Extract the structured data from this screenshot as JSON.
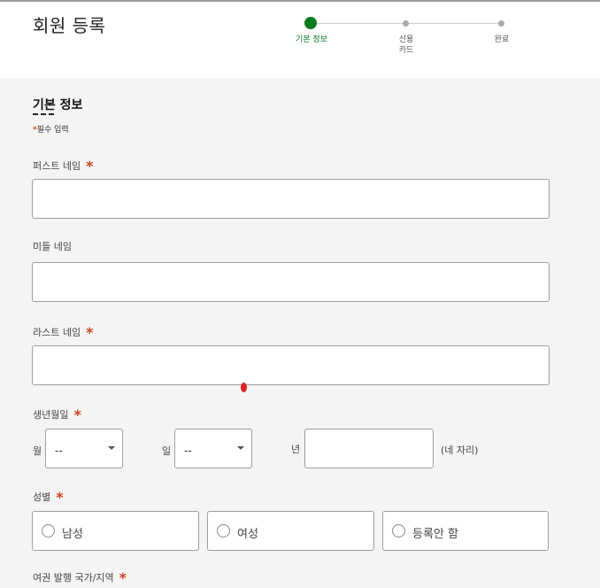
{
  "page": {
    "title": "회원 등록"
  },
  "stepper": {
    "steps": [
      {
        "label": "기본 정보",
        "state": "active"
      },
      {
        "label": "신용\n카드",
        "state": "pending"
      },
      {
        "label": "완료",
        "state": "pending"
      }
    ],
    "active_color": "#0a7a1f"
  },
  "form": {
    "section_title": "기본 정보",
    "required_star": "*",
    "required_note": "필수 입력",
    "first_name": {
      "label": "퍼스트 네임",
      "value": ""
    },
    "middle_name": {
      "label": "미들 네임",
      "value": ""
    },
    "last_name": {
      "label": "라스트 네임",
      "value": ""
    },
    "dob": {
      "label": "생년월일",
      "month_label": "월",
      "month_value": "--",
      "day_label": "일",
      "day_value": "--",
      "year_label": "년",
      "year_value": "",
      "year_hint": "(네 자리)"
    },
    "gender": {
      "label": "성별",
      "options": [
        "남성",
        "여성",
        "등록안 함"
      ]
    },
    "passport_country": {
      "label": "여권 발행 국가/지역"
    }
  },
  "colors": {
    "required": "#c8441c",
    "border": "#9e9e9e",
    "background": "#f4f4f4"
  }
}
